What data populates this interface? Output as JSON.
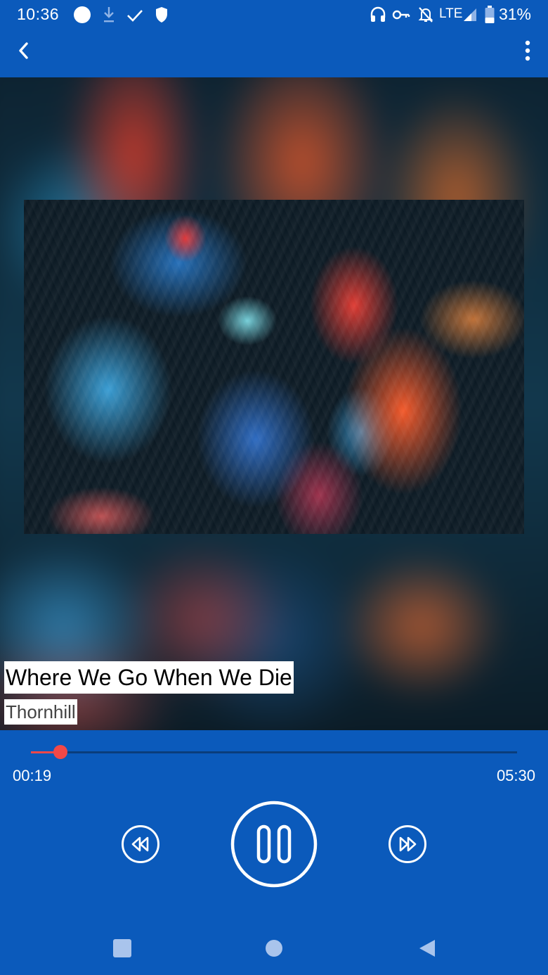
{
  "status_bar": {
    "time": "10:36",
    "network": "LTE",
    "battery": "31%",
    "icons": [
      "circle-icon",
      "download-icon",
      "check-icon",
      "shield-icon",
      "headset-icon",
      "vpn-key-icon",
      "notifications-off-icon",
      "signal-icon",
      "battery-icon"
    ]
  },
  "app_bar": {
    "back_icon": "chevron-left-icon",
    "menu_icon": "more-vert-icon"
  },
  "track": {
    "title": "Where We Go When We Die",
    "artist": "Thornhill"
  },
  "player": {
    "elapsed": "00:19",
    "duration": "05:30",
    "progress_fraction": 0.06,
    "accent_color": "#f24848",
    "background_color": "#0b5abb",
    "controls": [
      "rewind-icon",
      "pause-icon",
      "fast-forward-icon"
    ]
  },
  "nav_bar": {
    "buttons": [
      "recents-icon",
      "home-icon",
      "back-icon"
    ]
  }
}
